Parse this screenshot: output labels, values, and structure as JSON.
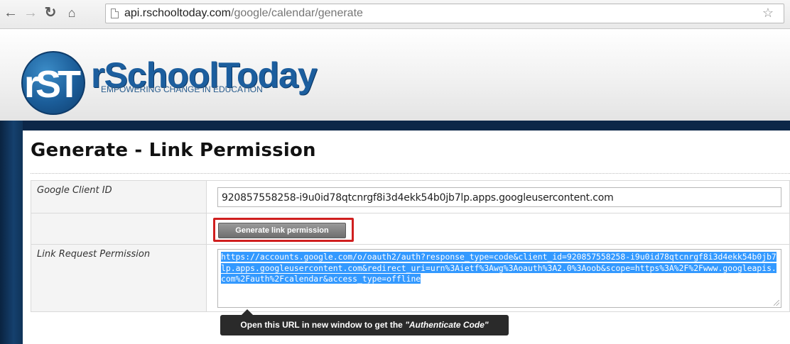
{
  "browser": {
    "url_host": "api.rschooltoday.com",
    "url_path": "/google/calendar/generate",
    "back_icon": "arrow-left-icon",
    "forward_icon": "arrow-right-icon",
    "reload_icon": "reload-icon",
    "home_icon": "home-icon",
    "star_icon": "star-icon"
  },
  "logo": {
    "mark": "rST",
    "name": "rSchoolToday",
    "tagline": "EMPOWERING CHANGE IN EDUCATION"
  },
  "page": {
    "title": "Generate - Link Permission"
  },
  "form": {
    "client_id_label": "Google Client ID",
    "client_id_value": "920857558258-i9u0id78qtcnrgf8i3d4ekk54b0jb7lp.apps.googleusercontent.com",
    "generate_button": "Generate link permission",
    "link_label": "Link Request Permission",
    "link_value": "https://accounts.google.com/o/oauth2/auth?response_type=code&client_id=920857558258-i9u0id78qtcnrgf8i3d4ekk54b0jb7lp.apps.googleusercontent.com&redirect_uri=urn%3Aietf%3Awg%3Aoauth%3A2.0%3Aoob&scope=https%3A%2F%2Fwww.googleapis.com%2Fauth%2Fcalendar&access_type=offline"
  },
  "tooltip": {
    "prefix": "Open this URL in new window to get the ",
    "emphasis": "\"Authenticate Code\""
  },
  "colors": {
    "brand_blue": "#1c5e9e",
    "highlight_red": "#d01f1f",
    "selection_blue": "#3399ff",
    "header_dark": "#0c2748"
  }
}
